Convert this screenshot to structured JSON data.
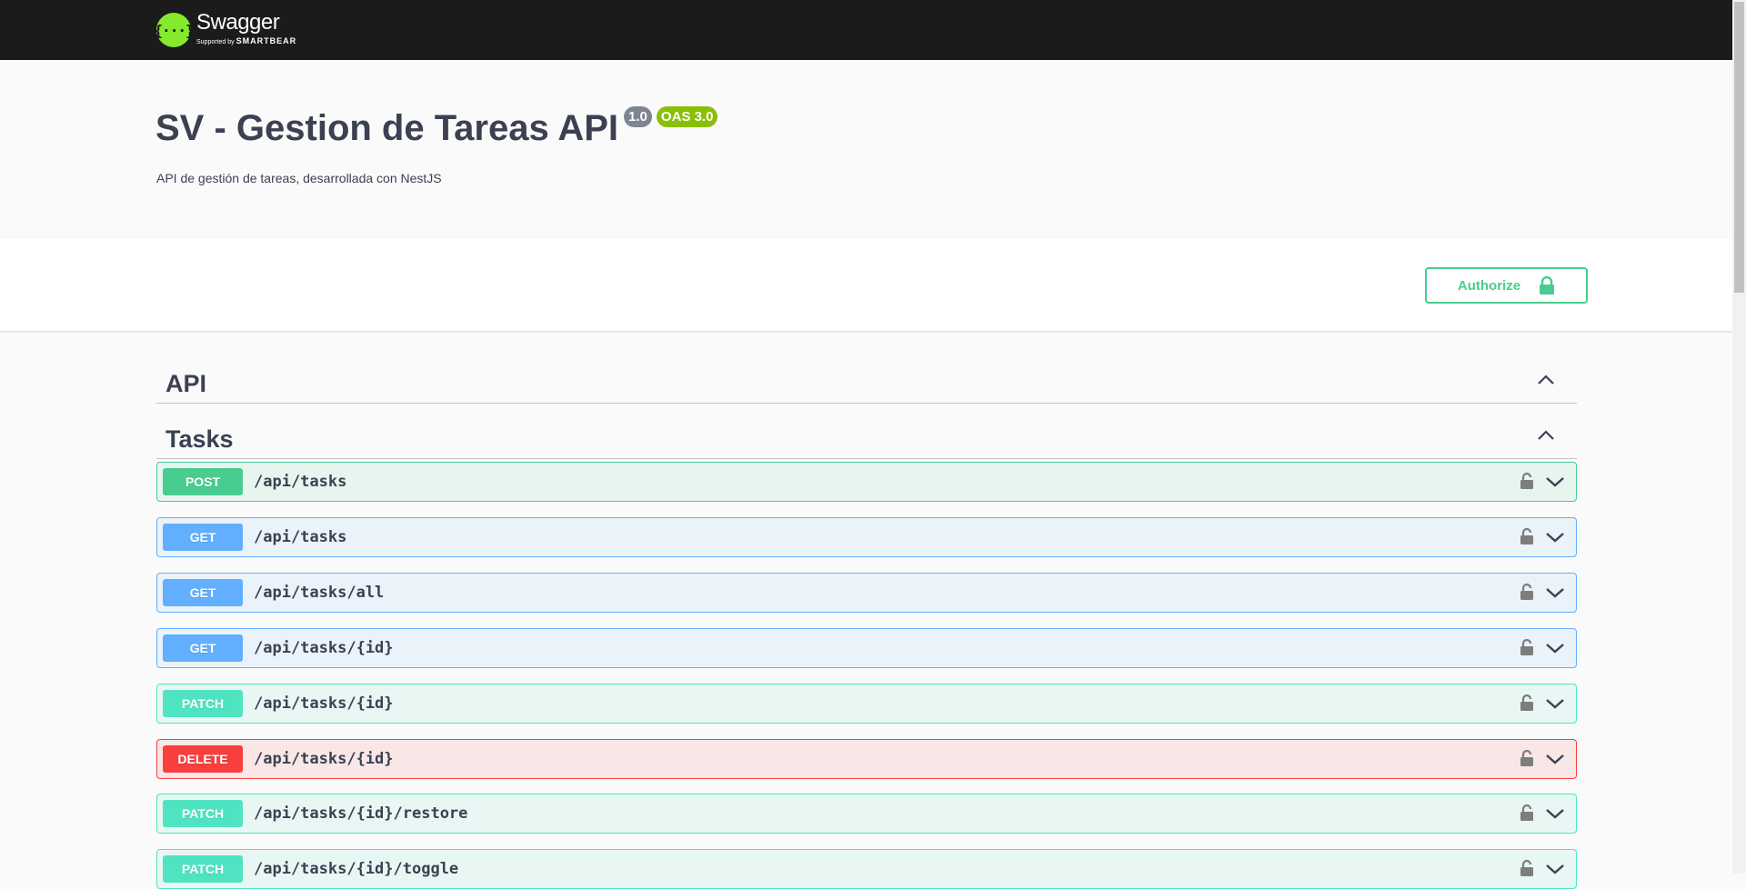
{
  "header": {
    "logo_glyph": "{···}",
    "logo_name": "Swagger",
    "logo_sub_prefix": "Supported by",
    "logo_sub_brand": "SMARTBEAR"
  },
  "info": {
    "title": "SV - Gestion de Tareas API",
    "version": "1.0",
    "oas": "OAS 3.0",
    "description": "API de gestión de tareas, desarrollada con NestJS"
  },
  "authorize": {
    "label": "Authorize"
  },
  "sections": [
    {
      "title": "API"
    },
    {
      "title": "Tasks"
    }
  ],
  "operations": [
    {
      "method": "POST",
      "path": "/api/tasks"
    },
    {
      "method": "GET",
      "path": "/api/tasks"
    },
    {
      "method": "GET",
      "path": "/api/tasks/all"
    },
    {
      "method": "GET",
      "path": "/api/tasks/{id}"
    },
    {
      "method": "PATCH",
      "path": "/api/tasks/{id}"
    },
    {
      "method": "DELETE",
      "path": "/api/tasks/{id}"
    },
    {
      "method": "PATCH",
      "path": "/api/tasks/{id}/restore"
    },
    {
      "method": "PATCH",
      "path": "/api/tasks/{id}/toggle"
    }
  ],
  "colors": {
    "post": "#49cc90",
    "get": "#61affe",
    "patch": "#50e3c2",
    "delete": "#f93e3e",
    "topbar": "#1b1b1b",
    "logo": "#85ea2d"
  }
}
